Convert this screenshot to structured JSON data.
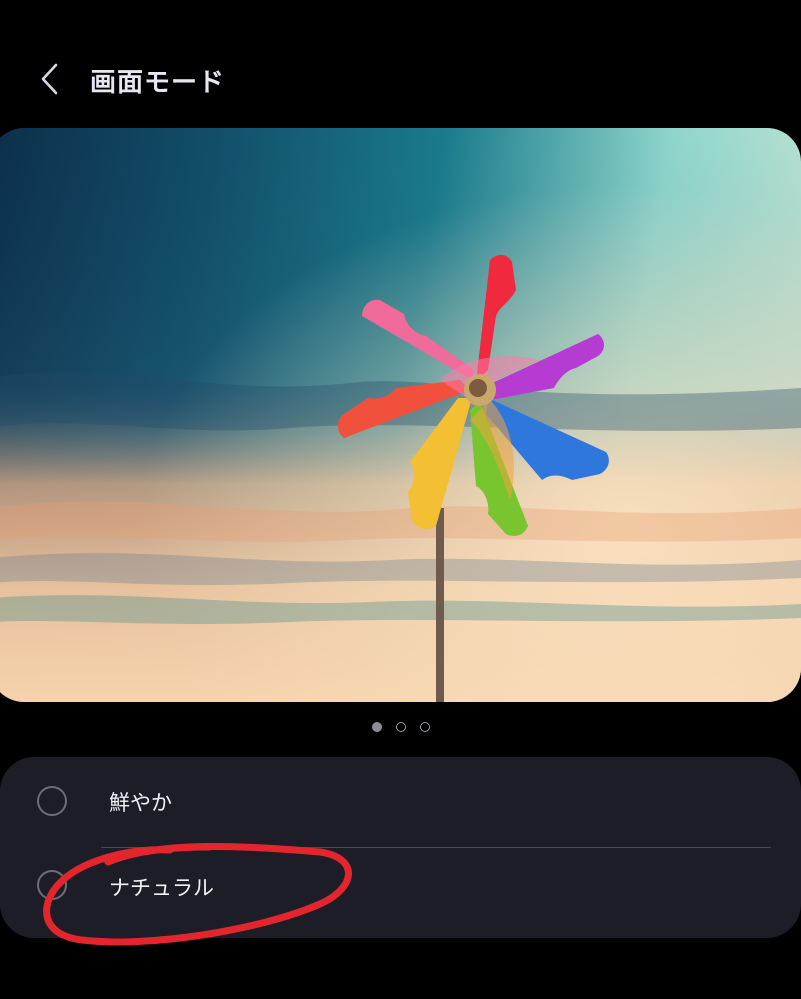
{
  "header": {
    "back_icon": "chevron-left-icon",
    "title": "画面モード"
  },
  "preview": {
    "image_subject": "pinwheel",
    "pages": 3,
    "active_page": 1
  },
  "options": [
    {
      "label": "鮮やか",
      "selected": false
    },
    {
      "label": "ナチュラル",
      "selected": false
    }
  ],
  "colors": {
    "background": "#000000",
    "panel": "#1d1d27",
    "title": "#e8e6f2",
    "annotation": "#e3262d"
  }
}
